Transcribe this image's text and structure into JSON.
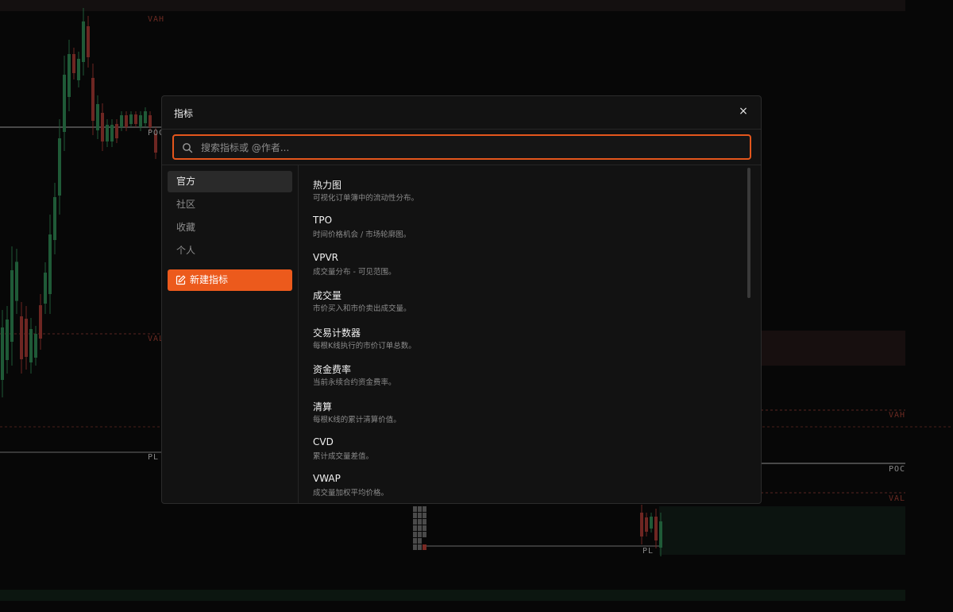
{
  "chart": {
    "labels": {
      "vah_top": "VAH",
      "poc_left": "POC",
      "val_left": "VAL",
      "pl_left": "PL",
      "vah_right": "VAH",
      "poc_right": "POC",
      "val_right": "VAL",
      "pl_mid": "PL"
    }
  },
  "modal": {
    "title": "指标",
    "close_glyph": "×",
    "search": {
      "placeholder": "搜索指标或 @作者...",
      "value": ""
    },
    "sidebar": {
      "items": [
        {
          "label": "官方",
          "active": true
        },
        {
          "label": "社区",
          "active": false
        },
        {
          "label": "收藏",
          "active": false
        },
        {
          "label": "个人",
          "active": false
        }
      ],
      "new_button": "新建指标"
    },
    "indicators": [
      {
        "title": "热力图",
        "desc": "可视化订单簿中的流动性分布。"
      },
      {
        "title": "TPO",
        "desc": "时间价格机会 / 市场轮廓图。"
      },
      {
        "title": "VPVR",
        "desc": "成交量分布 - 可见范围。"
      },
      {
        "title": "成交量",
        "desc": "市价买入和市价卖出成交量。"
      },
      {
        "title": "交易计数器",
        "desc": "每根K线执行的市价订单总数。"
      },
      {
        "title": "资金费率",
        "desc": "当前永续合约资金费率。"
      },
      {
        "title": "清算",
        "desc": "每根K线的累计清算价值。"
      },
      {
        "title": "CVD",
        "desc": "累计成交量差值。"
      },
      {
        "title": "VWAP",
        "desc": "成交量加权平均价格。"
      }
    ]
  },
  "colors": {
    "accent": "#ec5a1c",
    "candle_up": "#1f5a37",
    "candle_down": "#6e2622"
  },
  "icons": {
    "search": "search-icon",
    "close": "close-icon",
    "edit": "edit-icon"
  }
}
